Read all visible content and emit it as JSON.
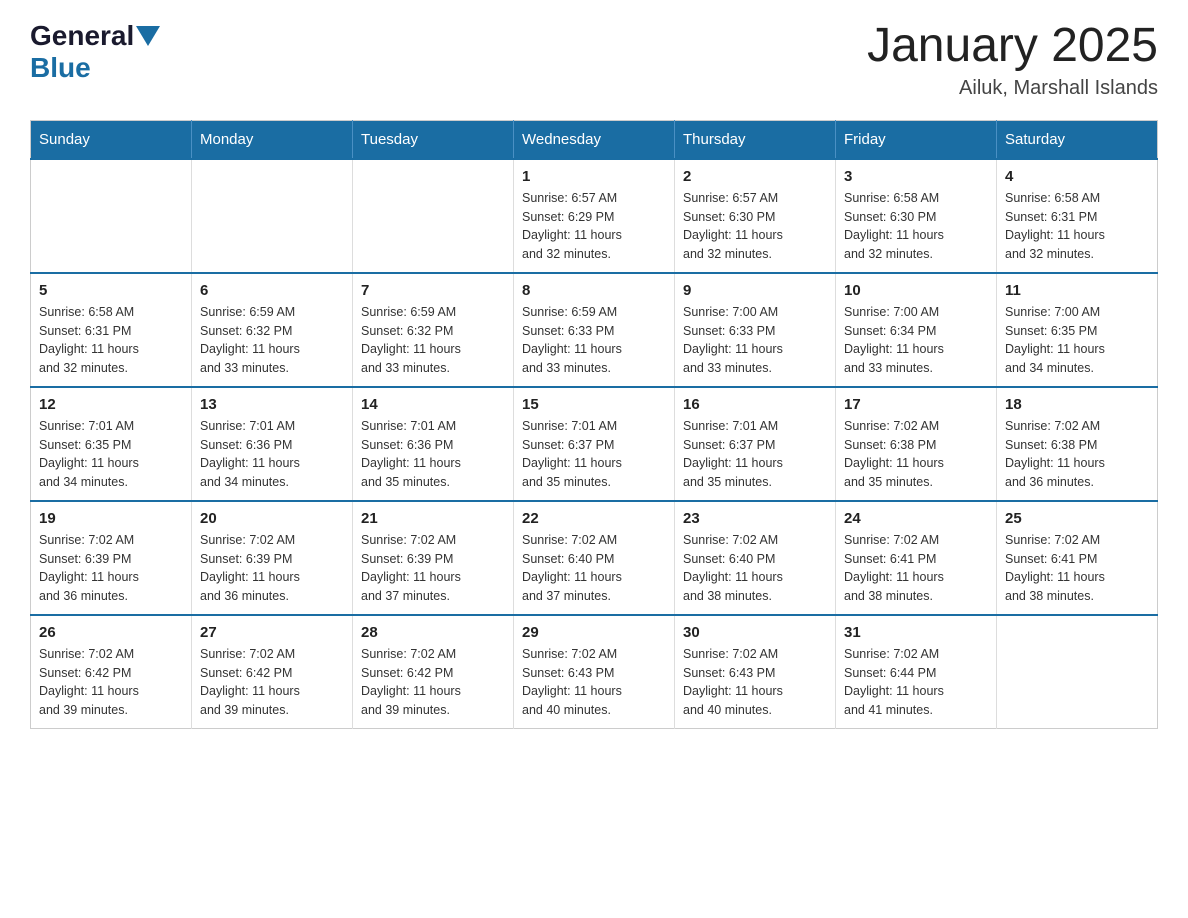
{
  "logo": {
    "general": "General",
    "blue": "Blue"
  },
  "title": "January 2025",
  "subtitle": "Ailuk, Marshall Islands",
  "days_of_week": [
    "Sunday",
    "Monday",
    "Tuesday",
    "Wednesday",
    "Thursday",
    "Friday",
    "Saturday"
  ],
  "weeks": [
    [
      {
        "day": "",
        "info": ""
      },
      {
        "day": "",
        "info": ""
      },
      {
        "day": "",
        "info": ""
      },
      {
        "day": "1",
        "info": "Sunrise: 6:57 AM\nSunset: 6:29 PM\nDaylight: 11 hours\nand 32 minutes."
      },
      {
        "day": "2",
        "info": "Sunrise: 6:57 AM\nSunset: 6:30 PM\nDaylight: 11 hours\nand 32 minutes."
      },
      {
        "day": "3",
        "info": "Sunrise: 6:58 AM\nSunset: 6:30 PM\nDaylight: 11 hours\nand 32 minutes."
      },
      {
        "day": "4",
        "info": "Sunrise: 6:58 AM\nSunset: 6:31 PM\nDaylight: 11 hours\nand 32 minutes."
      }
    ],
    [
      {
        "day": "5",
        "info": "Sunrise: 6:58 AM\nSunset: 6:31 PM\nDaylight: 11 hours\nand 32 minutes."
      },
      {
        "day": "6",
        "info": "Sunrise: 6:59 AM\nSunset: 6:32 PM\nDaylight: 11 hours\nand 33 minutes."
      },
      {
        "day": "7",
        "info": "Sunrise: 6:59 AM\nSunset: 6:32 PM\nDaylight: 11 hours\nand 33 minutes."
      },
      {
        "day": "8",
        "info": "Sunrise: 6:59 AM\nSunset: 6:33 PM\nDaylight: 11 hours\nand 33 minutes."
      },
      {
        "day": "9",
        "info": "Sunrise: 7:00 AM\nSunset: 6:33 PM\nDaylight: 11 hours\nand 33 minutes."
      },
      {
        "day": "10",
        "info": "Sunrise: 7:00 AM\nSunset: 6:34 PM\nDaylight: 11 hours\nand 33 minutes."
      },
      {
        "day": "11",
        "info": "Sunrise: 7:00 AM\nSunset: 6:35 PM\nDaylight: 11 hours\nand 34 minutes."
      }
    ],
    [
      {
        "day": "12",
        "info": "Sunrise: 7:01 AM\nSunset: 6:35 PM\nDaylight: 11 hours\nand 34 minutes."
      },
      {
        "day": "13",
        "info": "Sunrise: 7:01 AM\nSunset: 6:36 PM\nDaylight: 11 hours\nand 34 minutes."
      },
      {
        "day": "14",
        "info": "Sunrise: 7:01 AM\nSunset: 6:36 PM\nDaylight: 11 hours\nand 35 minutes."
      },
      {
        "day": "15",
        "info": "Sunrise: 7:01 AM\nSunset: 6:37 PM\nDaylight: 11 hours\nand 35 minutes."
      },
      {
        "day": "16",
        "info": "Sunrise: 7:01 AM\nSunset: 6:37 PM\nDaylight: 11 hours\nand 35 minutes."
      },
      {
        "day": "17",
        "info": "Sunrise: 7:02 AM\nSunset: 6:38 PM\nDaylight: 11 hours\nand 35 minutes."
      },
      {
        "day": "18",
        "info": "Sunrise: 7:02 AM\nSunset: 6:38 PM\nDaylight: 11 hours\nand 36 minutes."
      }
    ],
    [
      {
        "day": "19",
        "info": "Sunrise: 7:02 AM\nSunset: 6:39 PM\nDaylight: 11 hours\nand 36 minutes."
      },
      {
        "day": "20",
        "info": "Sunrise: 7:02 AM\nSunset: 6:39 PM\nDaylight: 11 hours\nand 36 minutes."
      },
      {
        "day": "21",
        "info": "Sunrise: 7:02 AM\nSunset: 6:39 PM\nDaylight: 11 hours\nand 37 minutes."
      },
      {
        "day": "22",
        "info": "Sunrise: 7:02 AM\nSunset: 6:40 PM\nDaylight: 11 hours\nand 37 minutes."
      },
      {
        "day": "23",
        "info": "Sunrise: 7:02 AM\nSunset: 6:40 PM\nDaylight: 11 hours\nand 38 minutes."
      },
      {
        "day": "24",
        "info": "Sunrise: 7:02 AM\nSunset: 6:41 PM\nDaylight: 11 hours\nand 38 minutes."
      },
      {
        "day": "25",
        "info": "Sunrise: 7:02 AM\nSunset: 6:41 PM\nDaylight: 11 hours\nand 38 minutes."
      }
    ],
    [
      {
        "day": "26",
        "info": "Sunrise: 7:02 AM\nSunset: 6:42 PM\nDaylight: 11 hours\nand 39 minutes."
      },
      {
        "day": "27",
        "info": "Sunrise: 7:02 AM\nSunset: 6:42 PM\nDaylight: 11 hours\nand 39 minutes."
      },
      {
        "day": "28",
        "info": "Sunrise: 7:02 AM\nSunset: 6:42 PM\nDaylight: 11 hours\nand 39 minutes."
      },
      {
        "day": "29",
        "info": "Sunrise: 7:02 AM\nSunset: 6:43 PM\nDaylight: 11 hours\nand 40 minutes."
      },
      {
        "day": "30",
        "info": "Sunrise: 7:02 AM\nSunset: 6:43 PM\nDaylight: 11 hours\nand 40 minutes."
      },
      {
        "day": "31",
        "info": "Sunrise: 7:02 AM\nSunset: 6:44 PM\nDaylight: 11 hours\nand 41 minutes."
      },
      {
        "day": "",
        "info": ""
      }
    ]
  ]
}
